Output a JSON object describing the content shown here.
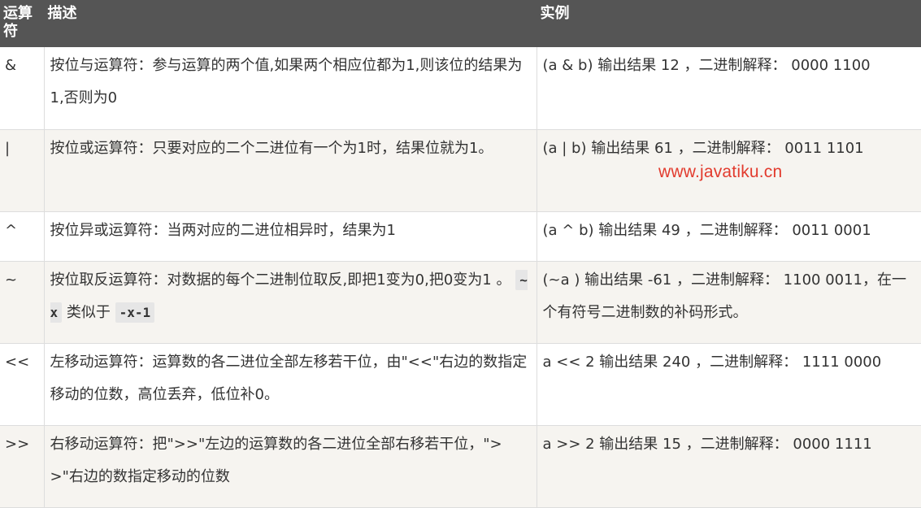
{
  "table": {
    "headers": {
      "operator": "运算符",
      "description": "描述",
      "example": "实例"
    },
    "rows": [
      {
        "operator": "&",
        "description": "按位与运算符：参与运算的两个值,如果两个相应位都为1,则该位的结果为1,否则为0",
        "example": "(a & b) 输出结果 12 ，二进制解释： 0000 1100"
      },
      {
        "operator": "|",
        "description": "按位或运算符：只要对应的二个二进位有一个为1时，结果位就为1。",
        "example": "(a | b) 输出结果 61 ，二进制解释： 0011 1101"
      },
      {
        "operator": "^",
        "description": "按位异或运算符：当两对应的二进位相异时，结果为1",
        "example": "(a ^ b) 输出结果 49 ，二进制解释： 0011 0001"
      },
      {
        "operator": "~",
        "description_main": "按位取反运算符：对数据的每个二进制位取反,即把1变为0,把0变为1 。",
        "code_1": "~x",
        "description_mid": "类似于",
        "code_2": "-x-1",
        "example": "(~a ) 输出结果 -61 ，二进制解释： 1100 0011，在一个有符号二进制数的补码形式。"
      },
      {
        "operator": "<<",
        "description": "左移动运算符：运算数的各二进位全部左移若干位，由\"<<\"右边的数指定移动的位数，高位丢弃，低位补0。",
        "example": "a << 2 输出结果 240 ，二进制解释： 1111 0000"
      },
      {
        "operator": ">>",
        "description": "右移动运算符：把\">>\"左边的运算数的各二进位全部右移若干位，\">>\"右边的数指定移动的位数",
        "example": "a >> 2 输出结果 15 ，二进制解释： 0000 1111"
      }
    ]
  },
  "watermark": "www.javatiku.cn",
  "colors": {
    "header_bg": "#555555",
    "header_text": "#ffffff",
    "row_alt_bg": "#f6f4f0",
    "border": "#dddddd",
    "watermark": "#e23b2e"
  }
}
